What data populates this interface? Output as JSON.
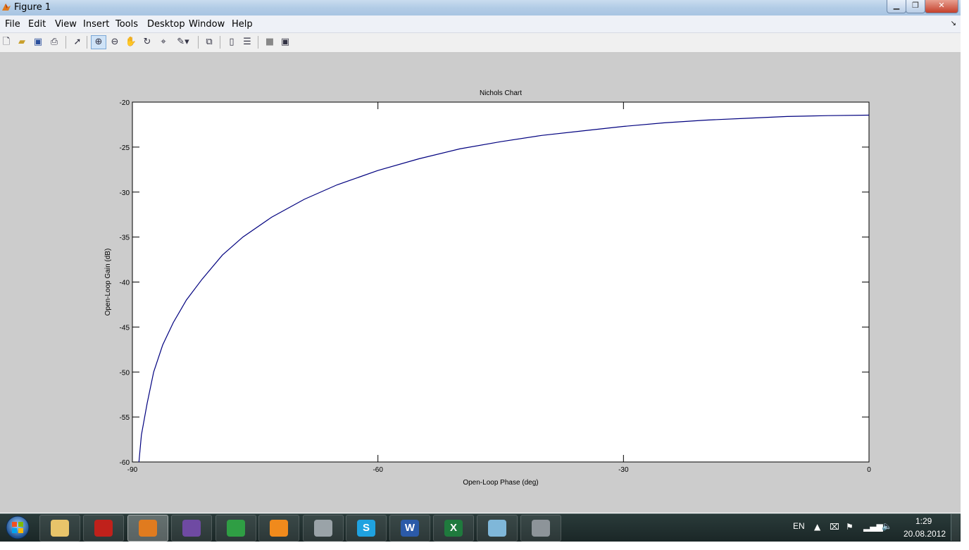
{
  "window": {
    "title": "Figure 1",
    "controls": [
      "minimize",
      "maximize",
      "close"
    ]
  },
  "menubar": {
    "items": [
      "File",
      "Edit",
      "View",
      "Insert",
      "Tools",
      "Desktop",
      "Window",
      "Help"
    ]
  },
  "toolbar": {
    "buttons": [
      "new-figure-icon",
      "open-file-icon",
      "save-icon",
      "print-icon",
      "select-arrow-icon",
      "zoom-in-icon",
      "zoom-out-icon",
      "pan-hand-icon",
      "rotate-3d-icon",
      "data-cursor-icon",
      "brush-icon",
      "link-plot-icon",
      "colorbar-icon",
      "legend-icon",
      "hide-plot-tools-icon",
      "show-plot-tools-icon"
    ],
    "active": "zoom-in-icon"
  },
  "chart_data": {
    "type": "line",
    "title": "Nichols Chart",
    "xlabel": "Open-Loop Phase (deg)",
    "ylabel": "Open-Loop Gain (dB)",
    "xlim": [
      -90,
      0
    ],
    "ylim": [
      -60,
      -20
    ],
    "xticks": [
      "-90",
      "-60",
      "-30",
      "0"
    ],
    "yticks": [
      "-20",
      "-25",
      "-30",
      "-35",
      "-40",
      "-45",
      "-50",
      "-55",
      "-60"
    ],
    "grid": false,
    "series": [
      {
        "color": "#00007f",
        "x": [
          -89.2,
          -88.9,
          -88.2,
          -87.4,
          -86.3,
          -85.0,
          -83.4,
          -81.5,
          -79.0,
          -76.5,
          -73.0,
          -69.0,
          -65.0,
          -60.0,
          -55.0,
          -50.0,
          -45.0,
          -40.0,
          -35.0,
          -30.0,
          -25.0,
          -20.0,
          -15.0,
          -10.0,
          -5.0,
          0.0
        ],
        "y": [
          -60.0,
          -57.0,
          -53.5,
          -50.0,
          -47.0,
          -44.5,
          -42.0,
          -39.7,
          -37.0,
          -35.0,
          -32.8,
          -30.8,
          -29.2,
          -27.6,
          -26.3,
          -25.2,
          -24.4,
          -23.7,
          -23.2,
          -22.7,
          -22.3,
          -22.0,
          -21.8,
          -21.6,
          -21.5,
          -21.45
        ]
      }
    ]
  },
  "taskbar": {
    "apps": [
      {
        "icon": "file-explorer-icon",
        "glyph": "",
        "color": "#e8c46a"
      },
      {
        "icon": "acrobat-icon",
        "glyph": "",
        "color": "#c0211b"
      },
      {
        "icon": "matlab-icon",
        "glyph": "",
        "color": "#e07b1f"
      },
      {
        "icon": "visual-studio-icon",
        "glyph": "",
        "color": "#6f4aa3"
      },
      {
        "icon": "chrome-icon",
        "glyph": "",
        "color": "#2f9e44"
      },
      {
        "icon": "media-player-icon",
        "glyph": "",
        "color": "#f08a1c"
      },
      {
        "icon": "clock-app-icon",
        "glyph": "",
        "color": "#9aa3a8"
      },
      {
        "icon": "skype-icon",
        "glyph": "S",
        "color": "#1fa2e0"
      },
      {
        "icon": "word-icon",
        "glyph": "W",
        "color": "#2b5aa8"
      },
      {
        "icon": "excel-icon",
        "glyph": "X",
        "color": "#1f7a3d"
      },
      {
        "icon": "notes-app-icon",
        "glyph": "",
        "color": "#7fb7d9"
      },
      {
        "icon": "speaker-app-icon",
        "glyph": "",
        "color": "#8d9499"
      }
    ],
    "language": "EN",
    "time": "1:29",
    "date": "20.08.2012"
  }
}
